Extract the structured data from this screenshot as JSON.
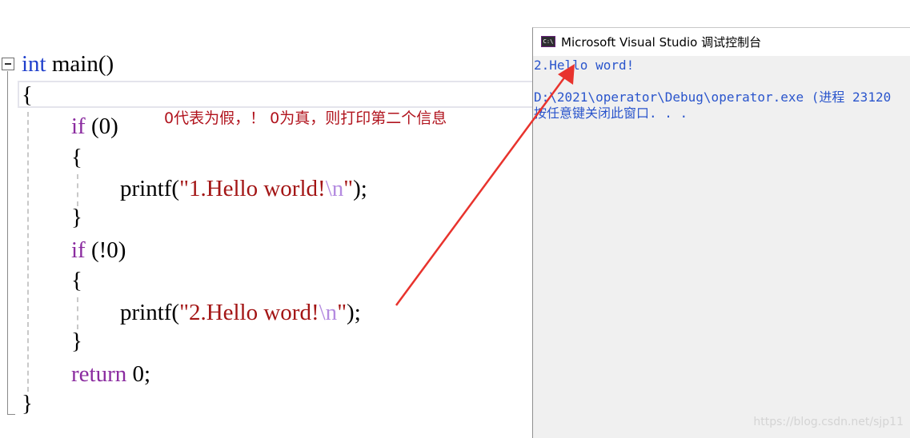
{
  "editor": {
    "lines": {
      "l1_kw": "int",
      "l1_rest": " main()",
      "l2": "{",
      "l3_kw": "if",
      "l3_rest": " (0)",
      "l4": "{",
      "l5_fn": "printf(",
      "l5_q1": "\"",
      "l5_str": "1.Hello world!",
      "l5_esc": "\\n",
      "l5_q2": "\"",
      "l5_end": ");",
      "l6": "}",
      "l7_kw": "if",
      "l7_rest": " (!0)",
      "l8": "{",
      "l9_fn": "printf(",
      "l9_q1": "\"",
      "l9_str": "2.Hello word!",
      "l9_esc": "\\n",
      "l9_q2": "\"",
      "l9_end": ");",
      "l10": "}",
      "l11_kw": "return",
      "l11_rest": " 0;",
      "l12": "}"
    },
    "annotation": "0代表为假，！ 0为真，则打印第二个信息",
    "colors": {
      "keyword": "#8b2ca0",
      "type_keyword": "#1f3fcc",
      "string": "#a31515",
      "escape": "#b48be0",
      "annotation": "#b1141e",
      "arrow": "#e8332d"
    }
  },
  "console": {
    "title": "Microsoft Visual Studio 调试控制台",
    "icon": "visual-studio-console-icon",
    "output": [
      "2.Hello word!",
      "",
      "D:\\2021\\operator\\Debug\\operator.exe (进程 23120",
      "按任意键关闭此窗口. . ."
    ],
    "text_color": "#2a55cc"
  },
  "watermark": "https://blog.csdn.net/sjp11"
}
